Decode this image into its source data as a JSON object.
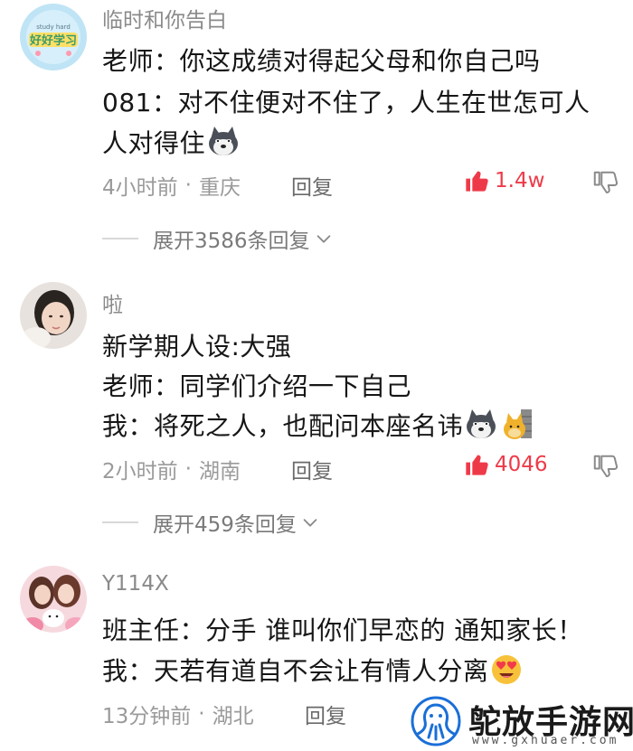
{
  "comments": [
    {
      "username": "临时和你告白",
      "avatar_text": "好好学习",
      "lines": [
        "老师：你这成绩对得起父母和你自己吗",
        "081：对不住便对不住了，人生在世怎可人",
        "人对得住"
      ],
      "time": "4小时前",
      "location": "重庆",
      "reply_label": "回复",
      "likes": "1.4w",
      "expand_label": "展开3586条回复"
    },
    {
      "username": "啦",
      "lines": [
        "新学期人设:大强",
        "老师：同学们介绍一下自己",
        "我：将死之人，也配问本座名讳"
      ],
      "time": "2小时前",
      "location": "湖南",
      "reply_label": "回复",
      "likes": "4046",
      "expand_label": "展开459条回复"
    },
    {
      "username": "Y114X",
      "lines": [
        "班主任：分手 谁叫你们早恋的 通知家长！",
        "我：天若有道自不会让有情人分离"
      ],
      "time": "13分钟前",
      "location": "湖北",
      "reply_label": "回复"
    }
  ],
  "separator": "·",
  "watermark": {
    "text": "鸵放手游网",
    "url": "www.gxhuaer.com"
  },
  "colors": {
    "like_red": "#ee3a48",
    "meta_gray": "#9a9a9a",
    "watermark_blue": "#1a6fd8"
  },
  "icons": [
    "thumbs-up-icon",
    "thumbs-down-icon",
    "chevron-down-icon",
    "husky-emoji-icon",
    "doge-emoji-icon",
    "heart-eyes-emoji-icon"
  ]
}
